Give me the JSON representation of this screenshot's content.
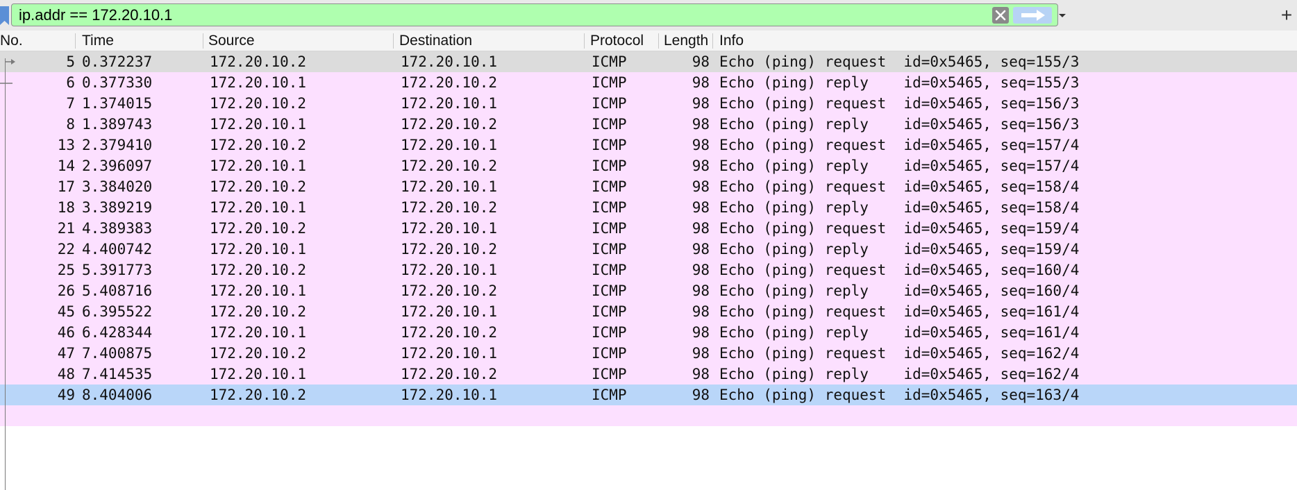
{
  "filter": {
    "value": "ip.addr == 172.20.10.1",
    "background": "#afffaf"
  },
  "icons": {
    "bookmark": "bookmark-icon",
    "clear": "clear-x-icon",
    "apply": "arrow-right-icon",
    "history": "chevron-down-icon",
    "add": "plus-icon"
  },
  "add_button_label": "+",
  "columns": [
    "No.",
    "Time",
    "Source",
    "Destination",
    "Protocol",
    "Length",
    "Info"
  ],
  "colors": {
    "row_icmp": "#fce0ff",
    "row_selected": "#b9d6f9",
    "row_marked": "#dcdcdc"
  },
  "packets": [
    {
      "no": "5",
      "time": "0.372237",
      "src": "172.20.10.2",
      "dst": "172.20.10.1",
      "proto": "ICMP",
      "len": "98",
      "info": "Echo (ping) request  id=0x5465, seq=155/3"
    },
    {
      "no": "6",
      "time": "0.377330",
      "src": "172.20.10.1",
      "dst": "172.20.10.2",
      "proto": "ICMP",
      "len": "98",
      "info": "Echo (ping) reply    id=0x5465, seq=155/3"
    },
    {
      "no": "7",
      "time": "1.374015",
      "src": "172.20.10.2",
      "dst": "172.20.10.1",
      "proto": "ICMP",
      "len": "98",
      "info": "Echo (ping) request  id=0x5465, seq=156/3"
    },
    {
      "no": "8",
      "time": "1.389743",
      "src": "172.20.10.1",
      "dst": "172.20.10.2",
      "proto": "ICMP",
      "len": "98",
      "info": "Echo (ping) reply    id=0x5465, seq=156/3"
    },
    {
      "no": "13",
      "time": "2.379410",
      "src": "172.20.10.2",
      "dst": "172.20.10.1",
      "proto": "ICMP",
      "len": "98",
      "info": "Echo (ping) request  id=0x5465, seq=157/4"
    },
    {
      "no": "14",
      "time": "2.396097",
      "src": "172.20.10.1",
      "dst": "172.20.10.2",
      "proto": "ICMP",
      "len": "98",
      "info": "Echo (ping) reply    id=0x5465, seq=157/4"
    },
    {
      "no": "17",
      "time": "3.384020",
      "src": "172.20.10.2",
      "dst": "172.20.10.1",
      "proto": "ICMP",
      "len": "98",
      "info": "Echo (ping) request  id=0x5465, seq=158/4"
    },
    {
      "no": "18",
      "time": "3.389219",
      "src": "172.20.10.1",
      "dst": "172.20.10.2",
      "proto": "ICMP",
      "len": "98",
      "info": "Echo (ping) reply    id=0x5465, seq=158/4"
    },
    {
      "no": "21",
      "time": "4.389383",
      "src": "172.20.10.2",
      "dst": "172.20.10.1",
      "proto": "ICMP",
      "len": "98",
      "info": "Echo (ping) request  id=0x5465, seq=159/4"
    },
    {
      "no": "22",
      "time": "4.400742",
      "src": "172.20.10.1",
      "dst": "172.20.10.2",
      "proto": "ICMP",
      "len": "98",
      "info": "Echo (ping) reply    id=0x5465, seq=159/4"
    },
    {
      "no": "25",
      "time": "5.391773",
      "src": "172.20.10.2",
      "dst": "172.20.10.1",
      "proto": "ICMP",
      "len": "98",
      "info": "Echo (ping) request  id=0x5465, seq=160/4"
    },
    {
      "no": "26",
      "time": "5.408716",
      "src": "172.20.10.1",
      "dst": "172.20.10.2",
      "proto": "ICMP",
      "len": "98",
      "info": "Echo (ping) reply    id=0x5465, seq=160/4"
    },
    {
      "no": "45",
      "time": "6.395522",
      "src": "172.20.10.2",
      "dst": "172.20.10.1",
      "proto": "ICMP",
      "len": "98",
      "info": "Echo (ping) request  id=0x5465, seq=161/4"
    },
    {
      "no": "46",
      "time": "6.428344",
      "src": "172.20.10.1",
      "dst": "172.20.10.2",
      "proto": "ICMP",
      "len": "98",
      "info": "Echo (ping) reply    id=0x5465, seq=161/4"
    },
    {
      "no": "47",
      "time": "7.400875",
      "src": "172.20.10.2",
      "dst": "172.20.10.1",
      "proto": "ICMP",
      "len": "98",
      "info": "Echo (ping) request  id=0x5465, seq=162/4"
    },
    {
      "no": "48",
      "time": "7.414535",
      "src": "172.20.10.1",
      "dst": "172.20.10.2",
      "proto": "ICMP",
      "len": "98",
      "info": "Echo (ping) reply    id=0x5465, seq=162/4"
    },
    {
      "no": "49",
      "time": "8.404006",
      "src": "172.20.10.2",
      "dst": "172.20.10.1",
      "proto": "ICMP",
      "len": "98",
      "info": "Echo (ping) request  id=0x5465, seq=163/4",
      "selected": true
    }
  ]
}
